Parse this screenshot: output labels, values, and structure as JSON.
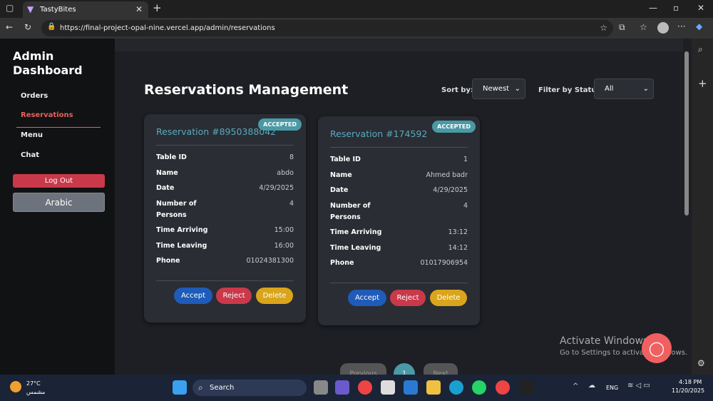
{
  "browser": {
    "tab_title": "TastyBites",
    "url": "https://final-project-opal-nine.vercel.app/admin/reservations"
  },
  "sidebar": {
    "title": "Admin Dashboard",
    "items": [
      "Orders",
      "Reservations",
      "Menu",
      "Chat"
    ],
    "logout": "Log Out",
    "language": "Arabic"
  },
  "main": {
    "title": "Reservations Management",
    "sort_label": "Sort by:",
    "sort_value": "Newest",
    "filter_label": "Filter by Status:",
    "filter_value": "All"
  },
  "labels": {
    "table": "Table ID",
    "name": "Name",
    "date": "Date",
    "persons": "Number of Persons",
    "arriving": "Time Arriving",
    "leaving": "Time Leaving",
    "phone": "Phone"
  },
  "reservations": [
    {
      "title": "Reservation #8950388042",
      "status": "ACCEPTED",
      "table": "8",
      "name": "abdo",
      "date": "4/29/2025",
      "persons": "4",
      "arriving": "15:00",
      "leaving": "16:00",
      "phone": "01024381300"
    },
    {
      "title": "Reservation #174592",
      "status": "ACCEPTED",
      "table": "1",
      "name": "Ahmed badr",
      "date": "4/29/2025",
      "persons": "4",
      "arriving": "13:12",
      "leaving": "14:12",
      "phone": "01017906954"
    }
  ],
  "actions": {
    "accept": "Accept",
    "reject": "Reject",
    "delete": "Delete"
  },
  "pagination": {
    "prev": "Previous",
    "page": "1",
    "next": "Next"
  },
  "watermark": {
    "line1": "Activate Windows",
    "line2": "Go to Settings to activate Windows."
  },
  "taskbar": {
    "weather": "27°C",
    "weather_desc": "مشمس",
    "search": "Search",
    "lang": "ENG",
    "time": "4:18 PM",
    "date": "11/20/2025"
  }
}
